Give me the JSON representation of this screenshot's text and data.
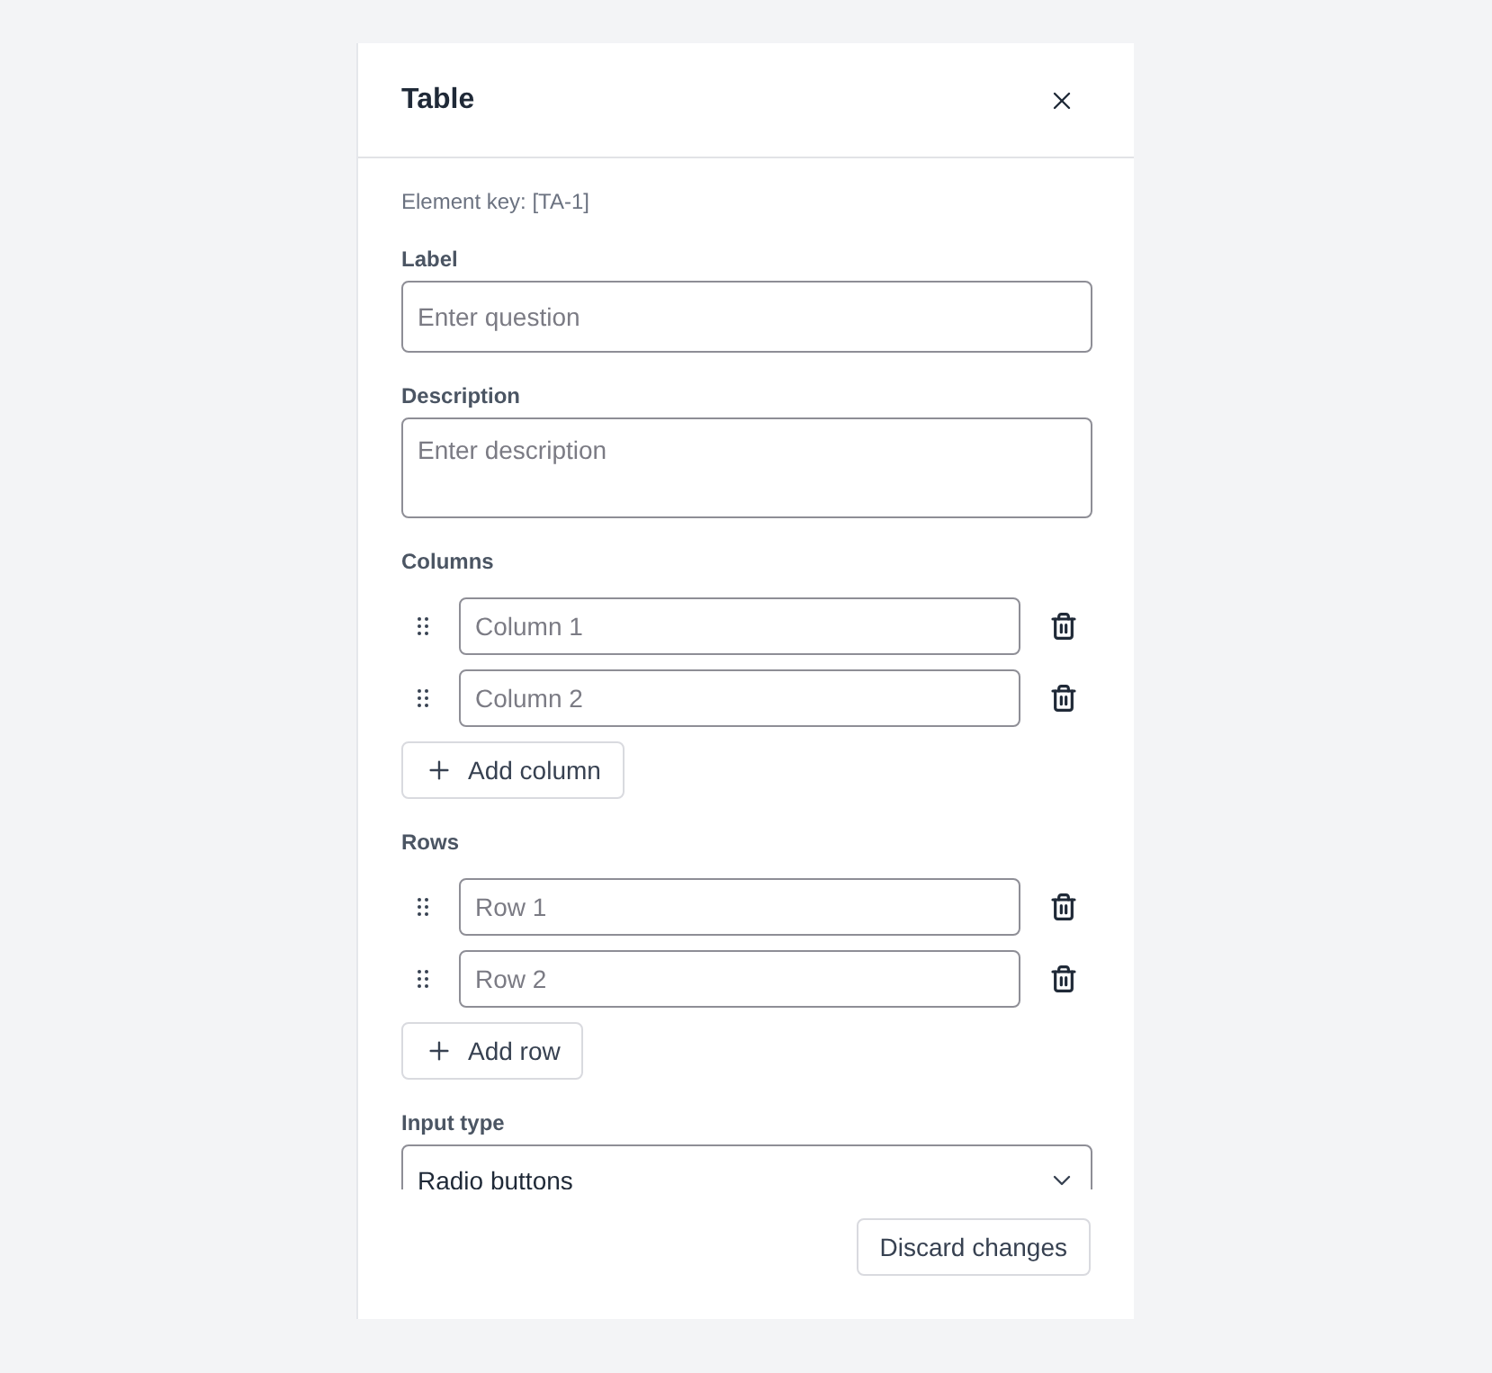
{
  "panel": {
    "title": "Table"
  },
  "element_key": "Element key: [TA-1]",
  "fields": [
    {
      "kind": "input",
      "label": "Label",
      "placeholder": "Enter question"
    },
    {
      "kind": "textarea",
      "label": "Description",
      "placeholder": "Enter description"
    }
  ],
  "lists": [
    {
      "label": "Columns",
      "items": [
        {
          "placeholder": "Column 1"
        },
        {
          "placeholder": "Column 2"
        }
      ],
      "add_button": "Add column"
    },
    {
      "label": "Rows",
      "items": [
        {
          "placeholder": "Row 1"
        },
        {
          "placeholder": "Row 2"
        }
      ],
      "add_button": "Add row"
    }
  ],
  "input_type": {
    "label": "Input type",
    "value": "Radio buttons"
  },
  "footer": {
    "button": "Discard changes"
  }
}
